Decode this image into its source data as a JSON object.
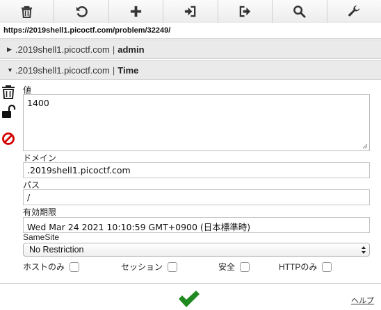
{
  "toolbar": {
    "icons": [
      "trash-icon",
      "undo-icon",
      "plus-icon",
      "import-icon",
      "export-icon",
      "search-icon",
      "wrench-icon"
    ]
  },
  "url": "https://2019shell1.picoctf.com/problem/32249/",
  "cookies": [
    {
      "domain": ".2019shell1.picoctf.com",
      "separator": "|",
      "name": "admin",
      "expanded": false
    },
    {
      "domain": ".2019shell1.picoctf.com",
      "separator": "|",
      "name": "Time",
      "expanded": true
    }
  ],
  "editor": {
    "value_label": "値",
    "value": "1400",
    "domain_label": "ドメイン",
    "domain": ".2019shell1.picoctf.com",
    "path_label": "パス",
    "path": "/",
    "expires_label": "有効期限",
    "expires": "Wed Mar 24 2021 10:10:59 GMT+0900 (日本標準時)",
    "samesite_label": "SameSite",
    "samesite": "No Restriction",
    "host_only_label": "ホストのみ",
    "session_label": "セッション",
    "secure_label": "安全",
    "http_only_label": "HTTPのみ",
    "host_only": false,
    "session": false,
    "secure": false,
    "http_only": false
  },
  "footer": {
    "help_label": "ヘルプ"
  },
  "colors": {
    "confirm": "#1f8a1f",
    "block": "#d40000"
  }
}
